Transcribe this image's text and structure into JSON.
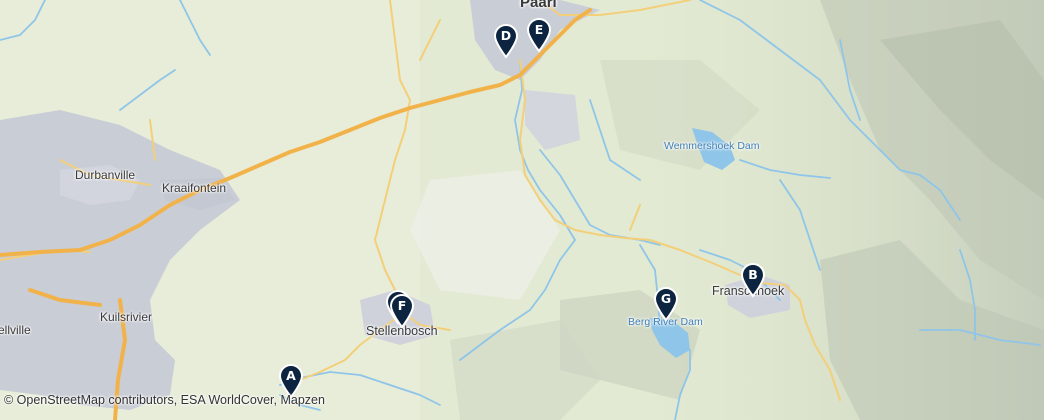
{
  "places": {
    "paarl": "Paarl",
    "durbanville": "Durbanville",
    "kraaifontein": "Kraaifontein",
    "kuilsrivier": "Kuilsrivier",
    "bellville": "Bellville",
    "stellenbosch": "Stellenbosch",
    "franschhoek": "Franschhoek",
    "wemmershoek_dam": "Wemmershoek Dam",
    "berg_river_dam": "Berg River Dam"
  },
  "markers": [
    "A",
    "B",
    "C",
    "D",
    "E",
    "F",
    "G"
  ],
  "attribution": "© OpenStreetMap contributors, ESA WorldCover, Mapzen",
  "colors": {
    "land": "#dfe8cf",
    "urban": "#c9cdd6",
    "water": "#8fc5e8",
    "highway": "#f2b24a",
    "road": "#f3cf7a",
    "marker": "#0d2440"
  }
}
